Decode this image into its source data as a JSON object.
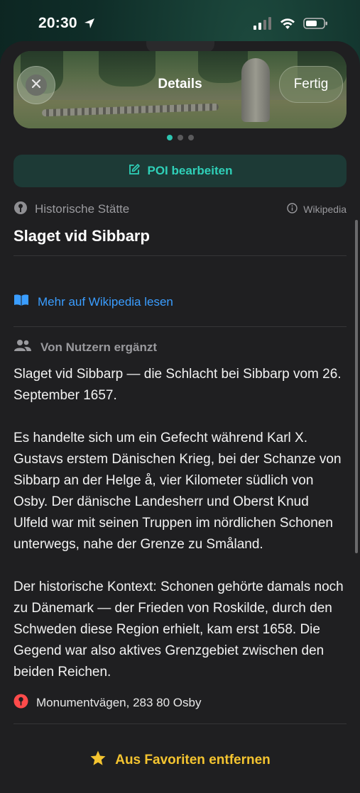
{
  "status_bar": {
    "time": "20:30"
  },
  "header": {
    "title": "Details",
    "done_label": "Fertig"
  },
  "carousel": {
    "page_count": 3,
    "active_index": 0
  },
  "actions": {
    "edit_poi_label": "POI bearbeiten"
  },
  "poi": {
    "category": "Historische Stätte",
    "source": "Wikipedia",
    "title": "Slaget vid Sibbarp",
    "wiki_link_label": "Mehr auf Wikipedia lesen",
    "user_section_label": "Von Nutzern ergänzt",
    "description": [
      "Slaget vid Sibbarp — die Schlacht bei Sibbarp vom 26. September 1657.",
      "Es handelte sich um ein Gefecht während Karl X. Gustavs erstem Dänischen Krieg, bei der Schanze von Sibbarp an der Helge å, vier Kilometer südlich von Osby. Der dänische Landesherr und Oberst Knud Ulfeld war mit seinen Truppen im nördlichen Schonen unterwegs, nahe der Grenze zu Småland.",
      "Der historische Kontext: Schonen gehörte damals noch zu Dänemark — der Frieden von Roskilde, durch den Schweden diese Region erhielt, kam erst 1658. Die Gegend war also aktives Grenzgebiet zwischen den beiden Reichen."
    ],
    "address": "Monumentvägen, 283 80 Osby",
    "favorite_label": "Aus Favoriten entfernen"
  },
  "colors": {
    "accent": "#2fd0b8",
    "link": "#3a9dff",
    "favorite": "#f4c430",
    "pin": "#ff4b4b",
    "sheet_background": "#1f1f21"
  }
}
